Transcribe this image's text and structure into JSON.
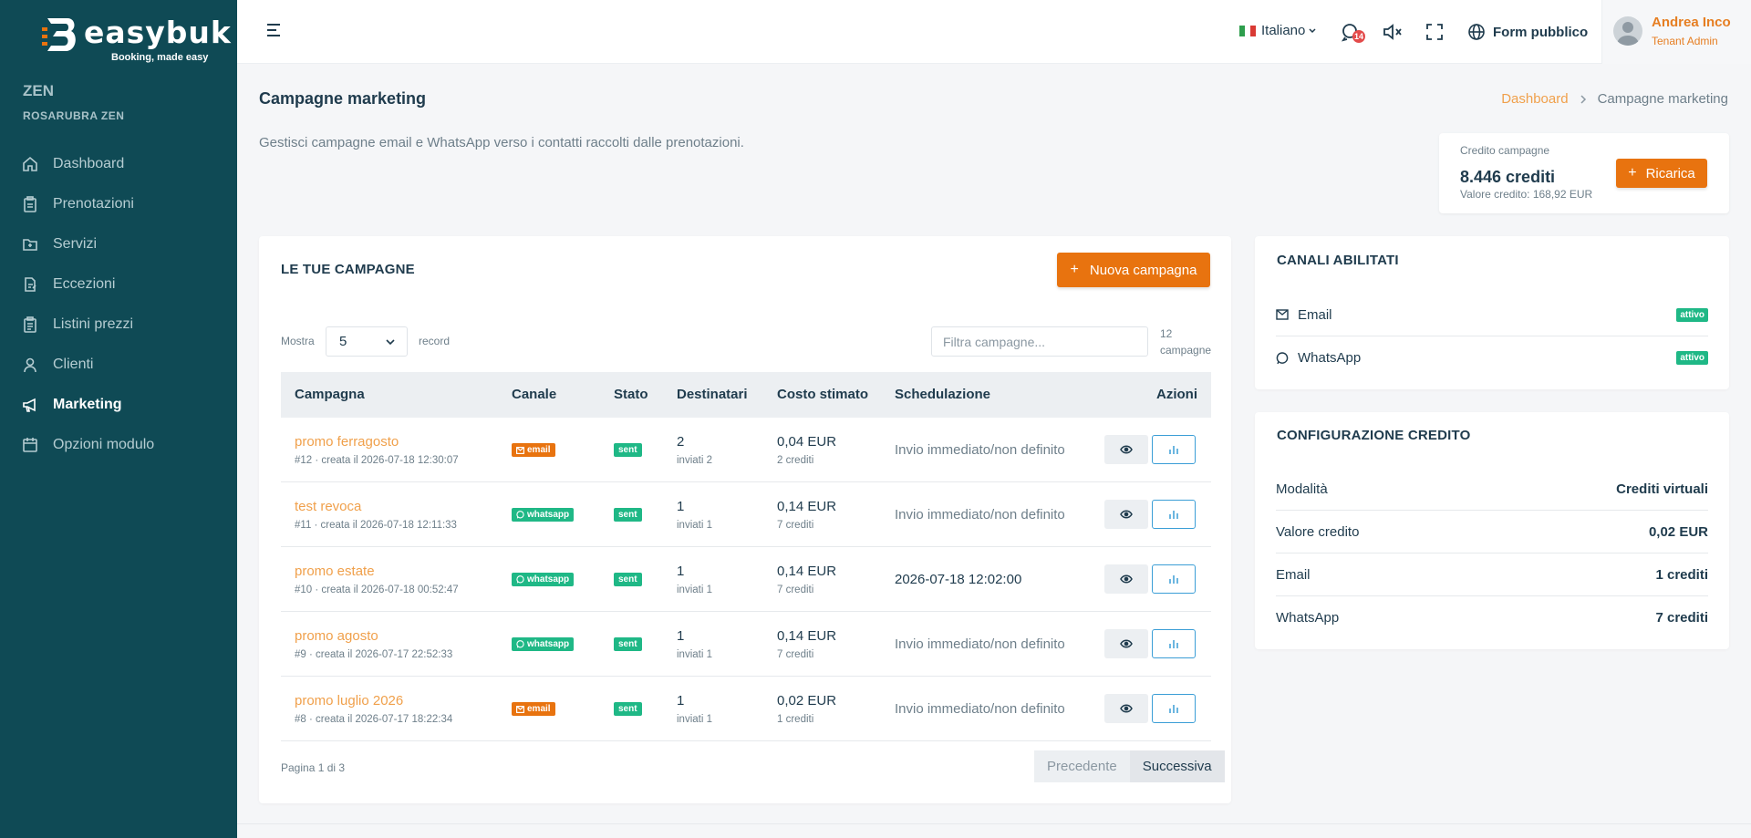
{
  "sidebar": {
    "brand": "easybuk",
    "tagline": "Booking, made easy",
    "org_title": "ZEN",
    "org_subtitle": "ROSARUBRA ZEN",
    "items": [
      {
        "label": "Dashboard",
        "icon": "home-icon"
      },
      {
        "label": "Prenotazioni",
        "icon": "clipboard-icon"
      },
      {
        "label": "Servizi",
        "icon": "folder-icon"
      },
      {
        "label": "Eccezioni",
        "icon": "file-edit-icon"
      },
      {
        "label": "Listini prezzi",
        "icon": "clipboard-list-icon"
      },
      {
        "label": "Clienti",
        "icon": "user-icon"
      },
      {
        "label": "Marketing",
        "icon": "megaphone-icon",
        "active": true
      },
      {
        "label": "Opzioni modulo",
        "icon": "calendar-icon"
      }
    ]
  },
  "topbar": {
    "language": "Italiano",
    "notification_count": "14",
    "form_label": "Form pubblico",
    "user_name": "Andrea Inco",
    "user_role": "Tenant Admin"
  },
  "page": {
    "title": "Campagne marketing",
    "breadcrumb": [
      "Dashboard",
      "Campagne marketing"
    ],
    "subtitle": "Gestisci campagne email e WhatsApp verso i contatti raccolti dalle prenotazioni."
  },
  "credit": {
    "label": "Credito campagne",
    "amount": "8.446 crediti",
    "value": "Valore credito: 168,92 EUR",
    "button": "Ricarica"
  },
  "campaigns": {
    "title": "LE TUE CAMPAGNE",
    "new_button": "Nuova campagna",
    "show_label": "Mostra",
    "page_size": "5",
    "record_label": "record",
    "filter_placeholder": "Filtra campagne...",
    "count_num": "12",
    "count_label": "campagne",
    "headers": {
      "name": "Campagna",
      "channel": "Canale",
      "status": "Stato",
      "recipients": "Destinatari",
      "cost": "Costo stimato",
      "schedule": "Schedulazione",
      "actions": "Azioni"
    },
    "rows": [
      {
        "name": "promo ferragosto",
        "meta": "#12 · creata il 2026-07-18 12:30:07",
        "channel": "email",
        "status": "sent",
        "recipients": "2",
        "sent": "inviati 2",
        "cost": "0,04 EUR",
        "credits": "2 crediti",
        "schedule": "Invio immediato/non definito"
      },
      {
        "name": "test revoca",
        "meta": "#11 · creata il 2026-07-18 12:11:33",
        "channel": "whatsapp",
        "status": "sent",
        "recipients": "1",
        "sent": "inviati 1",
        "cost": "0,14 EUR",
        "credits": "7 crediti",
        "schedule": "Invio immediato/non definito"
      },
      {
        "name": "promo estate",
        "meta": "#10 · creata il 2026-07-18 00:52:47",
        "channel": "whatsapp",
        "status": "sent",
        "recipients": "1",
        "sent": "inviati 1",
        "cost": "0,14 EUR",
        "credits": "7 crediti",
        "schedule": "2026-07-18 12:02:00"
      },
      {
        "name": "promo agosto",
        "meta": "#9 · creata il 2026-07-17 22:52:33",
        "channel": "whatsapp",
        "status": "sent",
        "recipients": "1",
        "sent": "inviati 1",
        "cost": "0,14 EUR",
        "credits": "7 crediti",
        "schedule": "Invio immediato/non definito"
      },
      {
        "name": "promo luglio 2026",
        "meta": "#8 · creata il 2026-07-17 18:22:34",
        "channel": "email",
        "status": "sent",
        "recipients": "1",
        "sent": "inviati 1",
        "cost": "0,02 EUR",
        "credits": "1 crediti",
        "schedule": "Invio immediato/non definito"
      }
    ],
    "page_info": "Pagina 1 di 3",
    "prev": "Precedente",
    "next": "Successiva"
  },
  "channels": {
    "title": "CANALI ABILITATI",
    "items": [
      {
        "label": "Email",
        "status": "attivo"
      },
      {
        "label": "WhatsApp",
        "status": "attivo"
      }
    ]
  },
  "config": {
    "title": "CONFIGURAZIONE CREDITO",
    "rows": [
      {
        "label": "Modalità",
        "value": "Crediti virtuali"
      },
      {
        "label": "Valore credito",
        "value": "0,02 EUR"
      },
      {
        "label": "Email",
        "value": "1 crediti"
      },
      {
        "label": "WhatsApp",
        "value": "7 crediti"
      }
    ]
  },
  "colors": {
    "sidebar": "#0f4a55",
    "accent": "#e8730f",
    "success": "#1fb886",
    "link": "#f0a04b"
  }
}
